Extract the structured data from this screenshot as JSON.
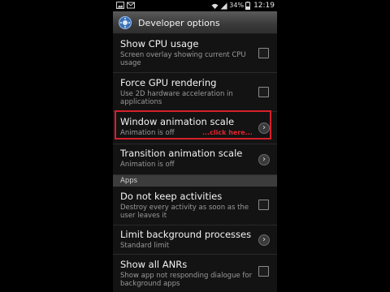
{
  "status_bar": {
    "battery": "34%",
    "time": "12:19"
  },
  "title_bar": {
    "title": "Developer options"
  },
  "items": [
    {
      "title": "Show CPU usage",
      "subtitle": "Screen overlay showing current CPU usage",
      "control": "checkbox",
      "checked": false
    },
    {
      "title": "Force GPU rendering",
      "subtitle": "Use 2D hardware acceleration in applications",
      "control": "checkbox",
      "checked": false
    },
    {
      "title": "Window animation scale",
      "subtitle": "Animation is off",
      "control": "chevron"
    },
    {
      "title": "Transition animation scale",
      "subtitle": "Animation is off",
      "control": "chevron"
    }
  ],
  "section": {
    "label": "Apps"
  },
  "apps_items": [
    {
      "title": "Do not keep activities",
      "subtitle": "Destroy every activity as soon as the user leaves it",
      "control": "checkbox",
      "checked": false
    },
    {
      "title": "Limit background processes",
      "subtitle": "Standard limit",
      "control": "chevron"
    },
    {
      "title": "Show all ANRs",
      "subtitle": "Show app not responding dialogue for background apps",
      "control": "checkbox",
      "checked": false
    }
  ],
  "annotation": {
    "text": "...click here..."
  },
  "colors": {
    "highlight": "#d6202a"
  }
}
